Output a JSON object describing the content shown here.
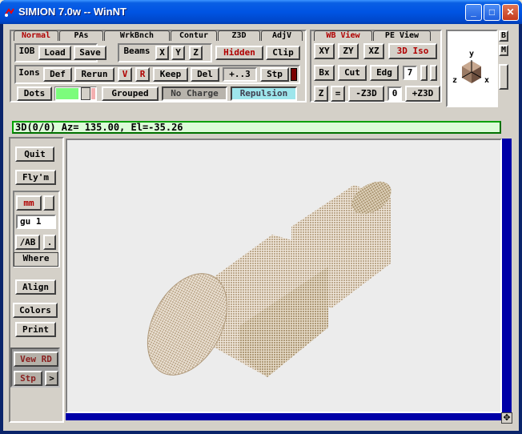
{
  "window": {
    "title": "SIMION 7.0w -- WinNT",
    "minimize": "_",
    "maximize": "□",
    "close": "✕"
  },
  "left_tabs": [
    "Normal",
    "PAs",
    "WrkBnch",
    "Contur",
    "Z3D",
    "AdjV"
  ],
  "right_tabs": [
    "WB View",
    "PE View"
  ],
  "row1": {
    "iob": "IOB",
    "load": "Load",
    "save": "Save",
    "beams": "Beams",
    "x": "X",
    "y": "Y",
    "z": "Z",
    "hidden": "Hidden",
    "clip": "Clip"
  },
  "row2": {
    "ions": "Ions",
    "def": "Def",
    "rerun": "Rerun",
    "v": "V",
    "r": "R",
    "keep": "Keep",
    "del": "Del",
    "spin": "+..3",
    "stp": "Stp"
  },
  "row3": {
    "dots": "Dots",
    "grouped": "Grouped",
    "no_charge": "No Charge",
    "repulsion": "Repulsion"
  },
  "view": {
    "xy": "XY",
    "zy": "ZY",
    "xz": "XZ",
    "iso": "3D Iso",
    "bx": "Bx",
    "cut": "Cut",
    "edg": "Edg",
    "seven": "7",
    "z": "Z",
    "eq": "=",
    "minus_z3d": "-Z3D",
    "zero": "0",
    "plus_z3d": "+Z3D"
  },
  "axes": {
    "y": "y",
    "z": "z",
    "x": "x"
  },
  "side_letters": {
    "b": "B",
    "m": "M"
  },
  "status": "3D(0/0) Az= 135.00, El=-35.26",
  "sidebar": {
    "quit": "Quit",
    "flym": "Fly'm",
    "mm": "mm",
    "gu": "gu  1",
    "ab": "/AB",
    "dot": ".",
    "where": "Where",
    "align": "Align",
    "colors": "Colors",
    "print": "Print",
    "vew_rd": "Vew RD",
    "stp": "Stp",
    "arrow": ">"
  },
  "colors": {
    "title_blue": "#0054e3",
    "scroll_blue": "#0000a8",
    "status_green": "#dcfcd8",
    "object": "#c8b49a",
    "hidden_red": "#b00000"
  }
}
